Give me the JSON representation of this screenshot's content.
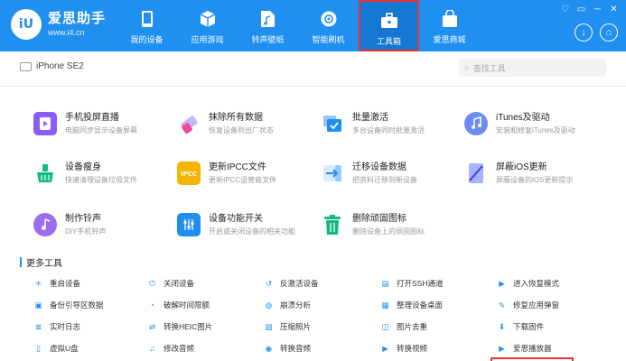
{
  "app": {
    "logo_mark": "iU",
    "name": "爱思助手",
    "url": "www.i4.cn"
  },
  "nav": [
    {
      "label": "我的设备",
      "icon": "phone-icon"
    },
    {
      "label": "应用游戏",
      "icon": "cube-icon"
    },
    {
      "label": "铃声壁纸",
      "icon": "music-file-icon"
    },
    {
      "label": "智能刷机",
      "icon": "flash-gear-icon"
    },
    {
      "label": "工具箱",
      "icon": "toolbox-icon",
      "active": true
    },
    {
      "label": "爱思商城",
      "icon": "shop-bag-icon"
    }
  ],
  "window_controls": [
    "shirt-icon",
    "minimize-icon",
    "restore-icon",
    "close-icon"
  ],
  "window_control_glyphs": [
    "♡",
    "▭",
    "─",
    "✕"
  ],
  "header_buttons": [
    {
      "icon": "download-icon",
      "glyph": "↓"
    },
    {
      "icon": "user-icon",
      "glyph": "⌂"
    }
  ],
  "device": {
    "name": "iPhone SE2"
  },
  "search": {
    "placeholder": "查找工具"
  },
  "tools": [
    {
      "title": "手机投屏直播",
      "desc": "电脑同步显示设备屏幕",
      "icon": "screen-mirror-icon",
      "color": "#8b5cf6"
    },
    {
      "title": "抹除所有数据",
      "desc": "恢复设备到出厂状态",
      "icon": "eraser-icon",
      "color": "#ec4899"
    },
    {
      "title": "批量激活",
      "desc": "多台设备同时批量激活",
      "icon": "batch-activate-icon",
      "color": "#1f8ff0"
    },
    {
      "title": "iTunes及驱动",
      "desc": "安装和修复iTunes及驱动",
      "icon": "itunes-icon",
      "color": "#6b8cf7"
    },
    {
      "title": "设备瘦身",
      "desc": "快速清理设备垃圾文件",
      "icon": "broom-icon",
      "color": "#10b981"
    },
    {
      "title": "更新IPCC文件",
      "desc": "更新IPCC运营商文件",
      "icon": "ipcc-file-icon",
      "color": "#f5b400"
    },
    {
      "title": "迁移设备数据",
      "desc": "把资料迁移到新设备",
      "icon": "migrate-icon",
      "color": "#1f8ff0"
    },
    {
      "title": "屏蔽iOS更新",
      "desc": "屏蔽设备的iOS更新提示",
      "icon": "block-update-icon",
      "color": "#7c8cf0"
    },
    {
      "title": "制作铃声",
      "desc": "DIY手机铃声",
      "icon": "ringtone-icon",
      "color": "#9b6cf0"
    },
    {
      "title": "设备功能开关",
      "desc": "开启或关闭设备的相关功能",
      "icon": "switch-sliders-icon",
      "color": "#1f8ff0"
    },
    {
      "title": "删除顽固图标",
      "desc": "删除设备上的顽固图标",
      "icon": "trash-icon",
      "color": "#10b981"
    }
  ],
  "more_tools_title": "更多工具",
  "more_tools": [
    {
      "label": "重启设备",
      "icon": "restart-icon",
      "color": "#1f8ff0",
      "glyph": "✳"
    },
    {
      "label": "关闭设备",
      "icon": "power-icon",
      "color": "#1f8ff0",
      "glyph": "⏻"
    },
    {
      "label": "反激活设备",
      "icon": "deactivate-icon",
      "color": "#1f8ff0",
      "glyph": "↺"
    },
    {
      "label": "打开SSH通道",
      "icon": "ssh-icon",
      "color": "#1f8ff0",
      "glyph": "▤"
    },
    {
      "label": "进入恢复模式",
      "icon": "recovery-mode-icon",
      "color": "#1f8ff0",
      "glyph": "▶"
    },
    {
      "label": "备份引导区数据",
      "icon": "backup-boot-icon",
      "color": "#1f8ff0",
      "glyph": "▣"
    },
    {
      "label": "破解时间限额",
      "icon": "time-limit-icon",
      "color": "#1f8ff0",
      "glyph": "◔"
    },
    {
      "label": "崩溃分析",
      "icon": "crash-analysis-icon",
      "color": "#1f8ff0",
      "glyph": "◍"
    },
    {
      "label": "整理设备桌面",
      "icon": "desktop-organize-icon",
      "color": "#1f8ff0",
      "glyph": "▦"
    },
    {
      "label": "修复应用弹窗",
      "icon": "fix-popup-icon",
      "color": "#1f8ff0",
      "glyph": "✎"
    },
    {
      "label": "实时日志",
      "icon": "realtime-log-icon",
      "color": "#1f8ff0",
      "glyph": "≣"
    },
    {
      "label": "转换HEIC图片",
      "icon": "heic-convert-icon",
      "color": "#1f8ff0",
      "glyph": "⇄"
    },
    {
      "label": "压缩照片",
      "icon": "compress-photo-icon",
      "color": "#1f8ff0",
      "glyph": "▧"
    },
    {
      "label": "图片去重",
      "icon": "dedupe-image-icon",
      "color": "#1f8ff0",
      "glyph": "◫"
    },
    {
      "label": "下载固件",
      "icon": "download-firmware-icon",
      "color": "#1f8ff0",
      "glyph": "⬇"
    },
    {
      "label": "虚拟U盘",
      "icon": "virtual-usb-icon",
      "color": "#1f8ff0",
      "glyph": "▯"
    },
    {
      "label": "修改音频",
      "icon": "edit-audio-icon",
      "color": "#1f8ff0",
      "glyph": "♫"
    },
    {
      "label": "转换音频",
      "icon": "convert-audio-icon",
      "color": "#1f8ff0",
      "glyph": "◉"
    },
    {
      "label": "转换视频",
      "icon": "convert-video-icon",
      "color": "#1f8ff0",
      "glyph": "▶"
    },
    {
      "label": "爱思播放器",
      "icon": "i4-player-icon",
      "color": "#1f8ff0",
      "glyph": "▶"
    }
  ]
}
